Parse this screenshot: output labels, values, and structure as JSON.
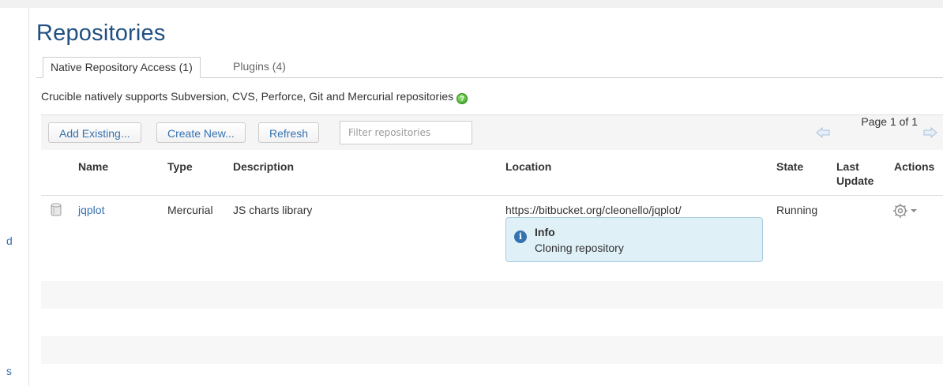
{
  "page": {
    "title": "Repositories",
    "left_fragments": [
      "d",
      "s"
    ]
  },
  "tabs": [
    {
      "label": "Native Repository Access (1)",
      "active": true
    },
    {
      "label": "Plugins (4)",
      "active": false
    }
  ],
  "intro": {
    "text": "Crucible natively supports Subversion, CVS, Perforce, Git and Mercurial repositories",
    "help_icon": "help-icon"
  },
  "toolbar": {
    "add_existing": "Add Existing...",
    "create_new": "Create New...",
    "refresh": "Refresh",
    "filter_placeholder": "Filter repositories",
    "filter_value": "",
    "page_label": "Page 1 of 1"
  },
  "table": {
    "columns": [
      "Name",
      "Type",
      "Description",
      "Location",
      "State",
      "Last Update",
      "Actions"
    ],
    "rows": [
      {
        "icon": "repository-icon",
        "name": "jqplot",
        "type": "Mercurial",
        "description": "JS charts library",
        "location": "https://bitbucket.org/cleonello/jqplot/",
        "state": "Running",
        "last_update": "",
        "actions_icon": "gear-icon",
        "info": {
          "title": "Info",
          "message": "Cloning repository"
        }
      }
    ]
  },
  "colors": {
    "title": "#205081",
    "link": "#3572b0",
    "info_bg": "#dff0f7",
    "info_border": "#a7cce0",
    "toolbar_bg": "#f5f5f5",
    "stripe": "#f7f7f7"
  }
}
